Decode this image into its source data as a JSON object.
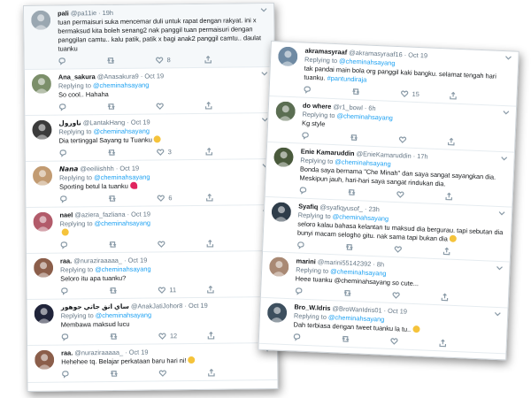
{
  "left_panel": {
    "tweets": [
      {
        "name": "pali",
        "handle": "@pa11ie",
        "time": "· 19h",
        "reply_prefix": "",
        "reply_mention": "",
        "text": "tuan permaisuri suka mencemar duli untuk rapat dengan rakyat. ini x bermaksud kita boleh senang2 nak panggil tuan permaisuri dengan panggilan camtu.. kalu patik, patik x bagi anak2 panggil camtu.. daulat tuanku",
        "hashtag": "",
        "emoji": "",
        "counts": {
          "reply": "",
          "retweet": "",
          "like": "8"
        },
        "avatar_color": "#9aa7b1"
      },
      {
        "name": "Ana_sakura",
        "handle": "@Anasakura9",
        "time": "· Oct 19",
        "reply_prefix": "Replying to",
        "reply_mention": "@cheminahsayang",
        "text": "So cool.. Hahaha",
        "hashtag": "",
        "emoji": "",
        "counts": {
          "reply": "",
          "retweet": "",
          "like": ""
        },
        "avatar_color": "#7c8f6a"
      },
      {
        "name": "ناورول",
        "handle": "@LantakHang",
        "time": "· Oct 19",
        "reply_prefix": "Replying to",
        "reply_mention": "@cheminahsayang",
        "text": "Dia tertinggal Sayang tu Tuanku",
        "hashtag": "",
        "emoji": "face",
        "counts": {
          "reply": "",
          "retweet": "",
          "like": "3"
        },
        "avatar_color": "#3b3b3b"
      },
      {
        "name": "𝙉𝙖𝙣𝙖",
        "handle": "@eeiliishhh",
        "time": "· Oct 19",
        "reply_prefix": "Replying to",
        "reply_mention": "@cheminahsayang",
        "text": "Sporting betul la tuanku",
        "hashtag": "",
        "emoji": "heart",
        "counts": {
          "reply": "",
          "retweet": "",
          "like": "6"
        },
        "avatar_color": "#c29b72"
      },
      {
        "name": "nael",
        "handle": "@aziera_fazliana",
        "time": "· Oct 19",
        "reply_prefix": "Replying to",
        "reply_mention": "@cheminahsayang",
        "text": "",
        "hashtag": "",
        "emoji": "face",
        "counts": {
          "reply": "",
          "retweet": "",
          "like": ""
        },
        "avatar_color": "#b25b6a"
      },
      {
        "name": "raa.",
        "handle": "@nuraziraaaaa_",
        "time": "· Oct 19",
        "reply_prefix": "Replying to",
        "reply_mention": "@cheminahsayang",
        "text": "Seloro itu apa tuanku?",
        "hashtag": "",
        "emoji": "",
        "counts": {
          "reply": "",
          "retweet": "",
          "like": "11"
        },
        "avatar_color": "#8b5e4a"
      },
      {
        "name": "ساي انق جاتي جوهور",
        "handle": "@AnakJatiJohor8",
        "time": "· Oct 19",
        "reply_prefix": "Replying to",
        "reply_mention": "@cheminahsayang",
        "text": "Membawa maksud lucu",
        "hashtag": "",
        "emoji": "",
        "counts": {
          "reply": "",
          "retweet": "",
          "like": "12"
        },
        "avatar_color": "#20243a"
      },
      {
        "name": "raa.",
        "handle": "@nuraziraaaaa_",
        "time": "· Oct 19",
        "reply_prefix": "",
        "reply_mention": "",
        "text": "Hehehee tq. Belajar perkataan baru hari ni!",
        "hashtag": "",
        "emoji": "face",
        "counts": {
          "reply": "",
          "retweet": "",
          "like": ""
        },
        "avatar_color": "#8b5e4a"
      }
    ]
  },
  "right_panel": {
    "tweets": [
      {
        "name": "akramasyraaf",
        "handle": "@akramasyraaf16",
        "time": "· Oct 19",
        "reply_prefix": "Replying to",
        "reply_mention": "@cheminahsayang",
        "text": "tak pandai main bola org panggil kaki bangku. selamat tengah hari tuanku.",
        "hashtag": "#pantundiraja",
        "emoji": "",
        "counts": {
          "reply": "",
          "retweet": "",
          "like": "15"
        },
        "avatar_color": "#6f8aa3"
      },
      {
        "name": "do where",
        "handle": "@r1_bowl",
        "time": "· 6h",
        "reply_prefix": "Replying to",
        "reply_mention": "@cheminahsayang",
        "text": "Kg style",
        "hashtag": "",
        "emoji": "",
        "counts": {
          "reply": "",
          "retweet": "",
          "like": ""
        },
        "avatar_color": "#5b6e52"
      },
      {
        "name": "Enie Kamaruddin",
        "handle": "@EnieKamaruddin",
        "time": "· 17h",
        "reply_prefix": "Replying to",
        "reply_mention": "@cheminahsayang",
        "text": "Bonda saya bernama \"Che Minah\" dan saya sangat sayangkan dia. Meskipun jauh, hari-hari saya sangat rindukan dia.",
        "hashtag": "",
        "emoji": "",
        "counts": {
          "reply": "",
          "retweet": "",
          "like": ""
        },
        "avatar_color": "#4a5a3c"
      },
      {
        "name": "Syafiq",
        "handle": "@syafiqyusof_",
        "time": "· 23h",
        "reply_prefix": "Replying to",
        "reply_mention": "@cheminahsayang",
        "text": "seloro kalau bahasa kelantan tu maksud dia bergurau. tapi sebutan dia bunyi macam selogho gitu. nak sama tapi bukan dia",
        "hashtag": "",
        "emoji": "face",
        "counts": {
          "reply": "",
          "retweet": "",
          "like": ""
        },
        "avatar_color": "#2f3d4a"
      },
      {
        "name": "marini",
        "handle": "@marini55142392",
        "time": "· 8h",
        "reply_prefix": "Replying to",
        "reply_mention": "@cheminahsayang",
        "text": "Heee tuanku @cheminahsayang so cute...",
        "hashtag": "",
        "emoji": "",
        "counts": {
          "reply": "",
          "retweet": "",
          "like": ""
        },
        "avatar_color": "#a98974"
      },
      {
        "name": "Bro_W.Idris",
        "handle": "@BroWanIdris01",
        "time": "· Oct 19",
        "reply_prefix": "Replying to",
        "reply_mention": "@cheminahsayang",
        "text": "Dah terbiasa dengan tweet tuanku la tu..",
        "hashtag": "",
        "emoji": "face",
        "counts": {
          "reply": "",
          "retweet": "",
          "like": ""
        },
        "avatar_color": "#3d4f5e"
      }
    ]
  }
}
